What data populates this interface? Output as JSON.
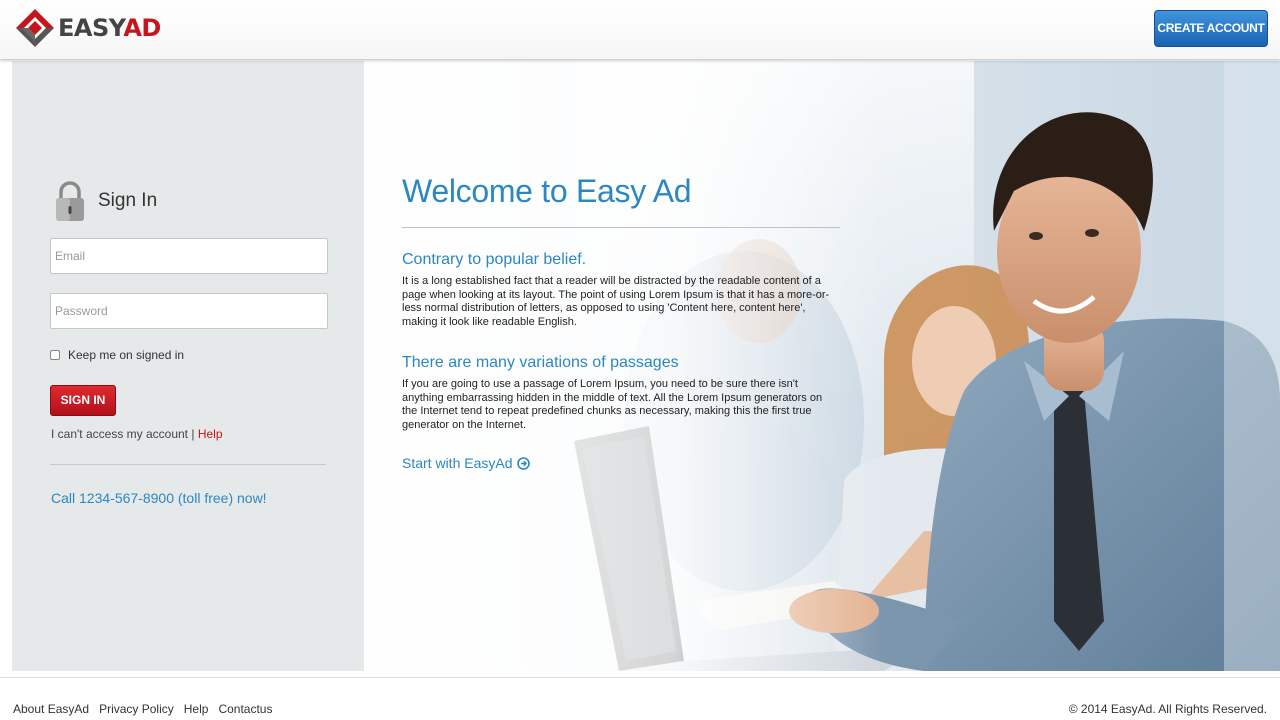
{
  "header": {
    "logo_easy": "EASY",
    "logo_ad": "AD",
    "create_account_label": "CREATE ACCOUNT"
  },
  "signin": {
    "title": "Sign In",
    "email_placeholder": "Email",
    "password_placeholder": "Password",
    "keep_signed_in_label": "Keep me on signed in",
    "keep_signed_in_checked": false,
    "button_label": "SIGN IN",
    "access_text": "I can't access my account |",
    "help_link": "Help",
    "call_text": "Call 1234-567-8900 (toll free) now!"
  },
  "hero": {
    "title": "Welcome to Easy Ad",
    "section1_title": "Contrary to popular belief.",
    "section1_text": "It is a long established fact that a reader will be distracted by the readable content of a page when looking at its layout. The point of using Lorem Ipsum is that it has a more-or-less normal distribution of letters, as opposed to using 'Content here, content here', making it look like readable English.",
    "section2_title": "There are many variations of passages",
    "section2_text": "If you are going to use a passage of Lorem Ipsum, you need to be sure there isn't anything embarrassing hidden in the middle of text. All the Lorem Ipsum generators on the Internet tend to repeat predefined chunks as necessary, making this the first true generator on the Internet.",
    "start_link": "Start with EasyAd"
  },
  "footer": {
    "links": [
      "About EasyAd",
      "Privacy Policy",
      "Help",
      "Contactus"
    ],
    "copyright": "© 2014 EasyAd. All Rights Reserved."
  },
  "colors": {
    "brand_red": "#c4161c",
    "link_blue": "#2d87c1",
    "button_blue": "#1b62b2",
    "sidebar_bg": "#e6e9ea"
  },
  "icons": [
    "easyad-logo-icon",
    "padlock-icon",
    "arrow-circle-right-icon"
  ]
}
